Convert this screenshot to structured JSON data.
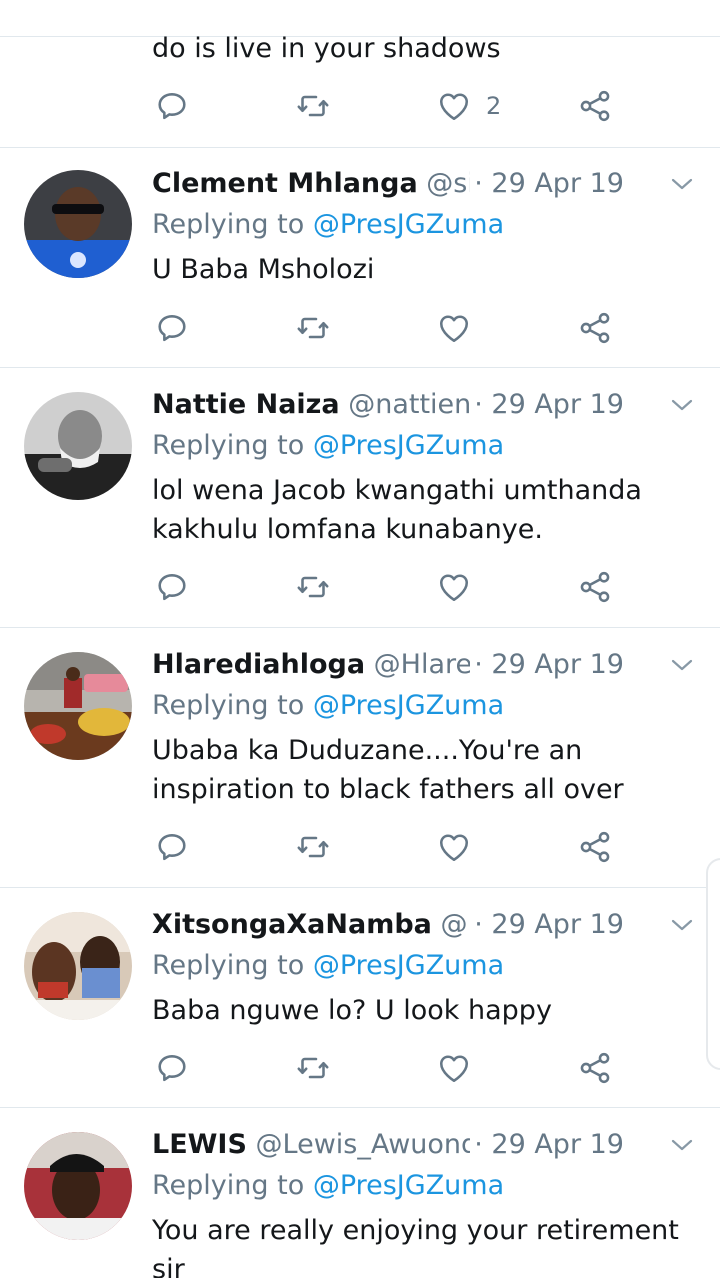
{
  "top_tweet": {
    "text": "do is live in your shadows",
    "like_count": "2"
  },
  "tweets": [
    {
      "name": "Clement Mhlanga",
      "handle": "@sirc…",
      "date": "· 29 Apr 19",
      "replying_prefix": "Replying to ",
      "replying_to": "@PresJGZuma",
      "text": "U Baba Msholozi"
    },
    {
      "name": "Nattie Naiza",
      "handle": "@nattienai…",
      "date": "· 29 Apr 19",
      "replying_prefix": "Replying to ",
      "replying_to": "@PresJGZuma",
      "text": "lol wena Jacob kwangathi umthanda kakhulu  lomfana kunabanye."
    },
    {
      "name": "Hlarediahloga",
      "handle": "@Hlaredi…",
      "date": "· 29 Apr 19",
      "replying_prefix": "Replying to ",
      "replying_to": "@PresJGZuma",
      "text": "Ubaba ka Duduzane....You're an inspiration to black fathers all over"
    },
    {
      "name": "XitsongaXaNamba",
      "handle": "@M…",
      "date": "· 29 Apr 19",
      "replying_prefix": "Replying to ",
      "replying_to": "@PresJGZuma",
      "text": "Baba nguwe lo? U look happy"
    },
    {
      "name": "LEWIS",
      "handle": "@Lewis_Awuonda",
      "date": "· 29 Apr 19",
      "replying_prefix": "Replying to ",
      "replying_to": "@PresJGZuma",
      "text": "You are really enjoying your retirement sir"
    }
  ],
  "icons": {
    "reply": "reply-icon",
    "retweet": "retweet-icon",
    "like": "heart-icon",
    "share": "share-icon",
    "menu": "chevron-down-icon"
  },
  "colors": {
    "link": "#1b95e0",
    "secondary_text": "#657786",
    "divider": "#e1e8ed"
  }
}
